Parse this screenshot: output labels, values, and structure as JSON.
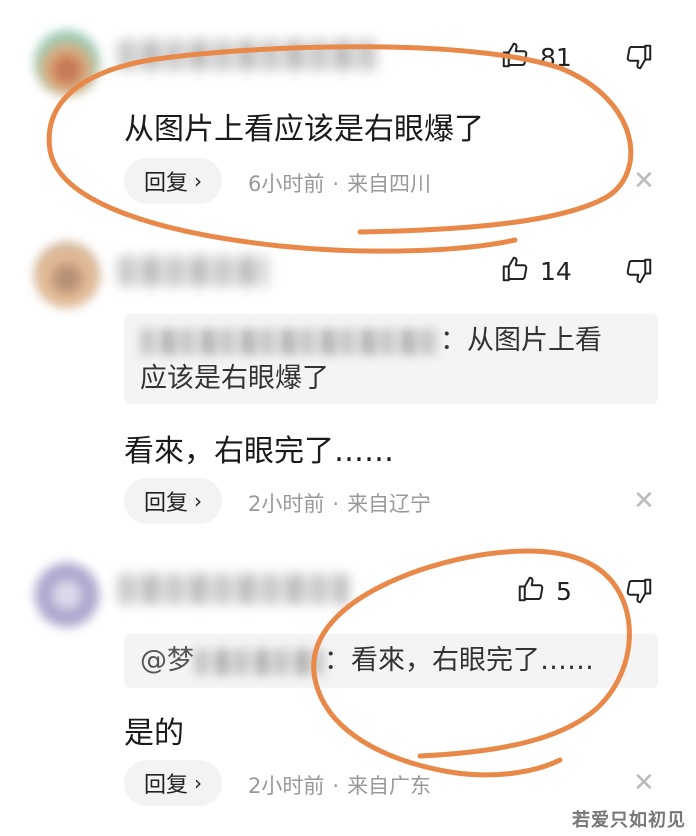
{
  "comments": [
    {
      "text": "从图片上看应该是右眼爆了",
      "like_count": "81",
      "reply_label": "回复",
      "time": "6小时前",
      "location": "来自四川",
      "avatar_colors": [
        "#8fc7b0",
        "#e0a06a",
        "#c06a45"
      ]
    },
    {
      "quote_suffix": "：从图片上看",
      "quote_line2": "应该是右眼爆了",
      "text": "看來，右眼完了……",
      "like_count": "14",
      "reply_label": "回复",
      "time": "2小时前",
      "location": "来自辽宁",
      "avatar_colors": [
        "#c9a98a",
        "#e8b98c",
        "#b08468"
      ]
    },
    {
      "quote_prefix": "@梦",
      "quote_suffix": "：看來，右眼完了……",
      "text": "是的",
      "like_count": "5",
      "reply_label": "回复",
      "time": "2小时前",
      "location": "来自广东",
      "avatar_colors": [
        "#b7b3d3",
        "#9b94c4",
        "#d8d6e8"
      ]
    }
  ],
  "watermark": "若爱只如初见",
  "colors": {
    "annotation": "#e8894a",
    "meta": "#999999",
    "reply_bg": "#f3f3f3"
  },
  "icons": {
    "like": "thumbs-up-icon",
    "dislike": "thumbs-down-icon",
    "close": "close-icon"
  }
}
